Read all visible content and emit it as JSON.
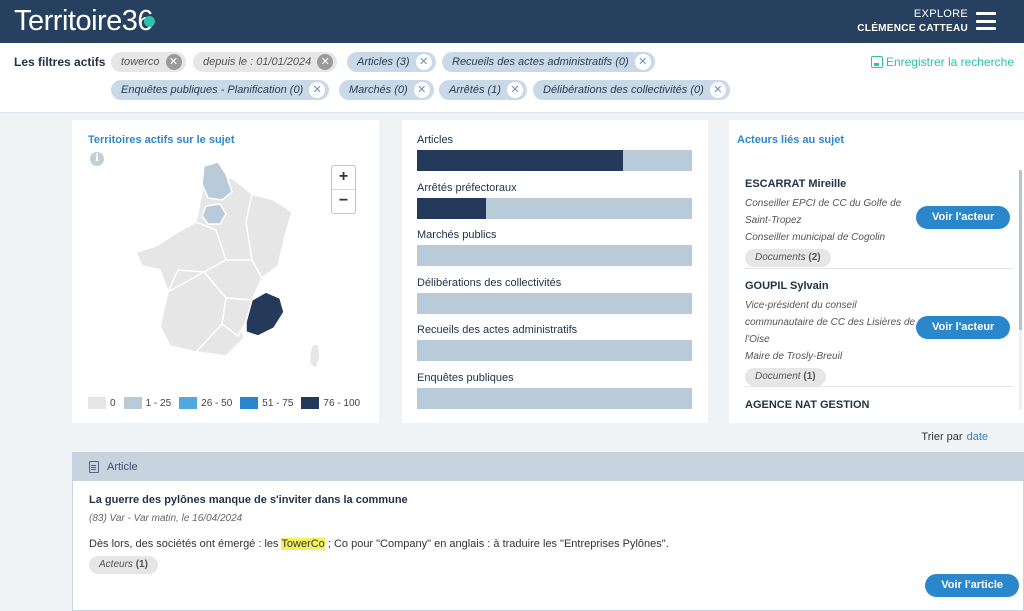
{
  "header": {
    "logo_text": "Territoire36",
    "explore": "EXPLORE",
    "user_name": "CLÉMENCE CATTEAU"
  },
  "filters": {
    "label": "Les filtres actifs",
    "chips": [
      {
        "label": "towerco",
        "style": "gray"
      },
      {
        "label": "depuis le : 01/01/2024",
        "style": "gray"
      },
      {
        "label": "Articles (3)",
        "style": "blue"
      },
      {
        "label": "Recueils des actes administratifs (0)",
        "style": "blue"
      },
      {
        "label": "Enquêtes publiques - Planification (0)",
        "style": "blue"
      },
      {
        "label": "Marchés (0)",
        "style": "blue"
      },
      {
        "label": "Arrêtés (1)",
        "style": "blue"
      },
      {
        "label": "Délibérations des collectivités (0)",
        "style": "blue"
      }
    ],
    "save_label": "Enregistrer la recherche"
  },
  "map_panel": {
    "title": "Territoires actifs sur le sujet",
    "legend": [
      {
        "label": "0",
        "color": "#e6e6e6"
      },
      {
        "label": "1 - 25",
        "color": "#b9cbd9"
      },
      {
        "label": "26 - 50",
        "color": "#4fa8de"
      },
      {
        "label": "51 - 75",
        "color": "#2a87cc"
      },
      {
        "label": "76 - 100",
        "color": "#253a5a"
      }
    ]
  },
  "bars_panel": {
    "items": [
      {
        "label": "Articles",
        "value": 0.75
      },
      {
        "label": "Arrêtés préfectoraux",
        "value": 0.25
      },
      {
        "label": "Marchés publics",
        "value": 0
      },
      {
        "label": "Délibérations des collectivités",
        "value": 0
      },
      {
        "label": "Recueils des actes administratifs",
        "value": 0
      },
      {
        "label": "Enquêtes publiques",
        "value": 0
      }
    ]
  },
  "actors_panel": {
    "title": "Acteurs liés au sujet",
    "actors": [
      {
        "name": "ESCARRAT Mireille",
        "roles": [
          "Conseiller EPCI de CC du Golfe de Saint-Tropez",
          "Conseiller municipal de Cogolin"
        ],
        "doc_label": "Documents",
        "doc_count": "(2)",
        "button": "Voir l'acteur"
      },
      {
        "name": "GOUPIL Sylvain",
        "roles": [
          "Vice-président du conseil communautaire de CC des Lisières de l'Oise",
          "Maire de Trosly-Breuil"
        ],
        "doc_label": "Document",
        "doc_count": "(1)",
        "button": "Voir l'acteur"
      },
      {
        "name": "AGENCE NAT GESTION"
      }
    ]
  },
  "sort": {
    "label": "Trier par",
    "value": "date"
  },
  "article": {
    "type_label": "Article",
    "title": "La guerre des pylônes manque de s'inviter dans la commune",
    "meta": "(83) Var - Var matin, le 16/04/2024",
    "text_before": "Dès lors, des sociétés ont émergé : les ",
    "text_highlight": "TowerCo",
    "text_after": " ; Co pour \"Company\" en anglais : à traduire les \"Entreprises Pylônes\".",
    "pill_label": "Acteurs",
    "pill_count": "(1)",
    "button": "Voir l'article"
  }
}
